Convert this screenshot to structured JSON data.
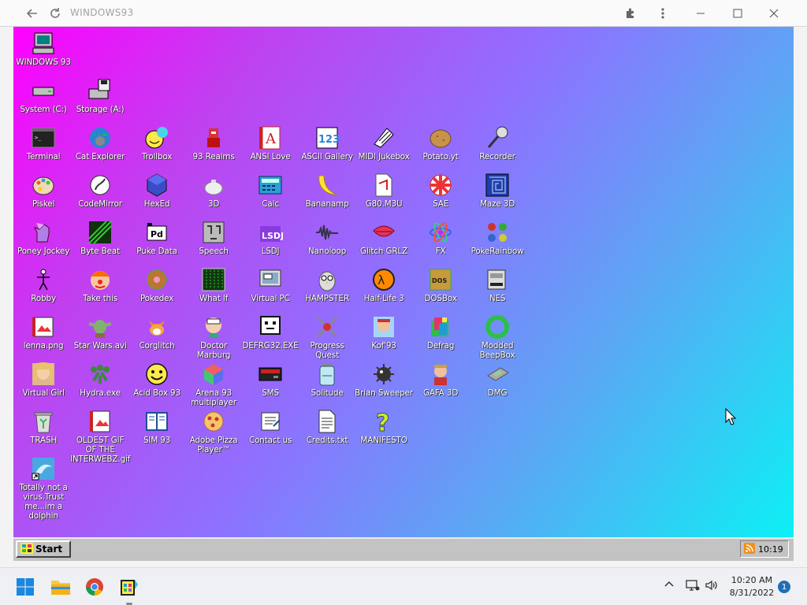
{
  "window": {
    "title": "WINDOWS93"
  },
  "desktop": {
    "icons": [
      {
        "label": "WINDOWS 93",
        "icon": "computer-icon"
      },
      {
        "label": "System (C:)",
        "icon": "hard-drive-icon"
      },
      {
        "label": "Storage (A:)",
        "icon": "floppy-drive-icon"
      },
      {
        "label": "Terminal",
        "icon": "terminal-icon"
      },
      {
        "label": "Cat Explorer",
        "icon": "cat-explorer-icon"
      },
      {
        "label": "Trollbox",
        "icon": "trollbox-icon"
      },
      {
        "label": "93 Realms",
        "icon": "realms-icon"
      },
      {
        "label": "ANSI Love",
        "icon": "ansi-love-icon"
      },
      {
        "label": "ASCII Gallery",
        "icon": "ascii-gallery-icon"
      },
      {
        "label": "MIDI Jukebox",
        "icon": "midi-jukebox-icon"
      },
      {
        "label": "Potato.yt",
        "icon": "potato-icon"
      },
      {
        "label": "Recorder",
        "icon": "microphone-icon"
      },
      {
        "label": "Piskel",
        "icon": "palette-icon"
      },
      {
        "label": "CodeMirror",
        "icon": "codemirror-icon"
      },
      {
        "label": "HexEd",
        "icon": "hex-cube-icon"
      },
      {
        "label": "3D",
        "icon": "teapot-icon"
      },
      {
        "label": "Calc",
        "icon": "calculator-icon"
      },
      {
        "label": "Bananamp",
        "icon": "banana-icon"
      },
      {
        "label": "G80.M3U",
        "icon": "playlist-file-icon"
      },
      {
        "label": "SAE",
        "icon": "amiga-ball-icon"
      },
      {
        "label": "Maze 3D",
        "icon": "maze-icon"
      },
      {
        "label": "Poney Jockey",
        "icon": "pony-icon"
      },
      {
        "label": "Byte Beat",
        "icon": "bytebeat-icon"
      },
      {
        "label": "Puke Data",
        "icon": "puredata-icon"
      },
      {
        "label": "Speech",
        "icon": "speech-face-icon"
      },
      {
        "label": "LSDJ",
        "icon": "lsdj-icon"
      },
      {
        "label": "Nanoloop",
        "icon": "waveform-icon"
      },
      {
        "label": "Glitch GRLZ",
        "icon": "lips-icon"
      },
      {
        "label": "FX",
        "icon": "atom-icon"
      },
      {
        "label": "PokeRainbow",
        "icon": "pokemon-trainers-icon"
      },
      {
        "label": "Robby",
        "icon": "stick-figure-icon"
      },
      {
        "label": "Take this",
        "icon": "clown-icon"
      },
      {
        "label": "Pokedex",
        "icon": "pokedex-icon"
      },
      {
        "label": "What If",
        "icon": "matrix-icon"
      },
      {
        "label": "Virtual PC",
        "icon": "virtual-pc-icon"
      },
      {
        "label": "HAMPSTER",
        "icon": "owl-icon"
      },
      {
        "label": "Half-Life 3",
        "icon": "half-life-icon"
      },
      {
        "label": "DOSBox",
        "icon": "dosbox-icon"
      },
      {
        "label": "NES",
        "icon": "nes-console-icon"
      },
      {
        "label": "lenna.png",
        "icon": "image-file-icon"
      },
      {
        "label": "Star Wars.avi",
        "icon": "yoda-icon"
      },
      {
        "label": "Corglitch",
        "icon": "corgi-icon"
      },
      {
        "label": "Doctor Marburg",
        "icon": "doctor-icon"
      },
      {
        "label": "DEFRG32.EXE",
        "icon": "defrag-face-icon"
      },
      {
        "label": "Progress Quest",
        "icon": "crossed-swords-icon"
      },
      {
        "label": "Kof'93",
        "icon": "fighter-icon"
      },
      {
        "label": "Defrag",
        "icon": "defrag-icon"
      },
      {
        "label": "Modded BeepBox",
        "icon": "green-ring-icon"
      },
      {
        "label": "Virtual Girl",
        "icon": "girl-portrait-icon"
      },
      {
        "label": "Hydra.exe",
        "icon": "hydra-icon"
      },
      {
        "label": "Acid Box 93",
        "icon": "smiley-icon"
      },
      {
        "label": "Arena 93 multiplayer",
        "icon": "rgb-cube-icon"
      },
      {
        "label": "SMS",
        "icon": "sms-console-icon"
      },
      {
        "label": "Solitude",
        "icon": "jar-icon"
      },
      {
        "label": "Brian Sweeper",
        "icon": "mine-icon"
      },
      {
        "label": "GAFA 3D",
        "icon": "duke-icon"
      },
      {
        "label": "DMG",
        "icon": "gameboy-icon"
      },
      {
        "label": "TRASH",
        "icon": "recycle-bin-icon"
      },
      {
        "label": "OLDEST GIF OF THE INTERWEBZ.gif",
        "icon": "gif-file-icon"
      },
      {
        "label": "SIM 93",
        "icon": "sim-book-icon"
      },
      {
        "label": "Adobe Pizza Player™",
        "icon": "pizza-icon"
      },
      {
        "label": "Contact us",
        "icon": "contact-note-icon"
      },
      {
        "label": "Credits.txt",
        "icon": "text-file-icon"
      },
      {
        "label": "MANIFESTO",
        "icon": "question-mark-icon"
      },
      {
        "label": "Totally not a virus.Trust me...im a dolphin",
        "icon": "dolphin-shortcut-icon"
      }
    ]
  },
  "w93_taskbar": {
    "start_label": "Start",
    "clock": "10:19"
  },
  "host_taskbar": {
    "time": "10:20 AM",
    "date": "8/31/2022",
    "notifications": "1"
  }
}
